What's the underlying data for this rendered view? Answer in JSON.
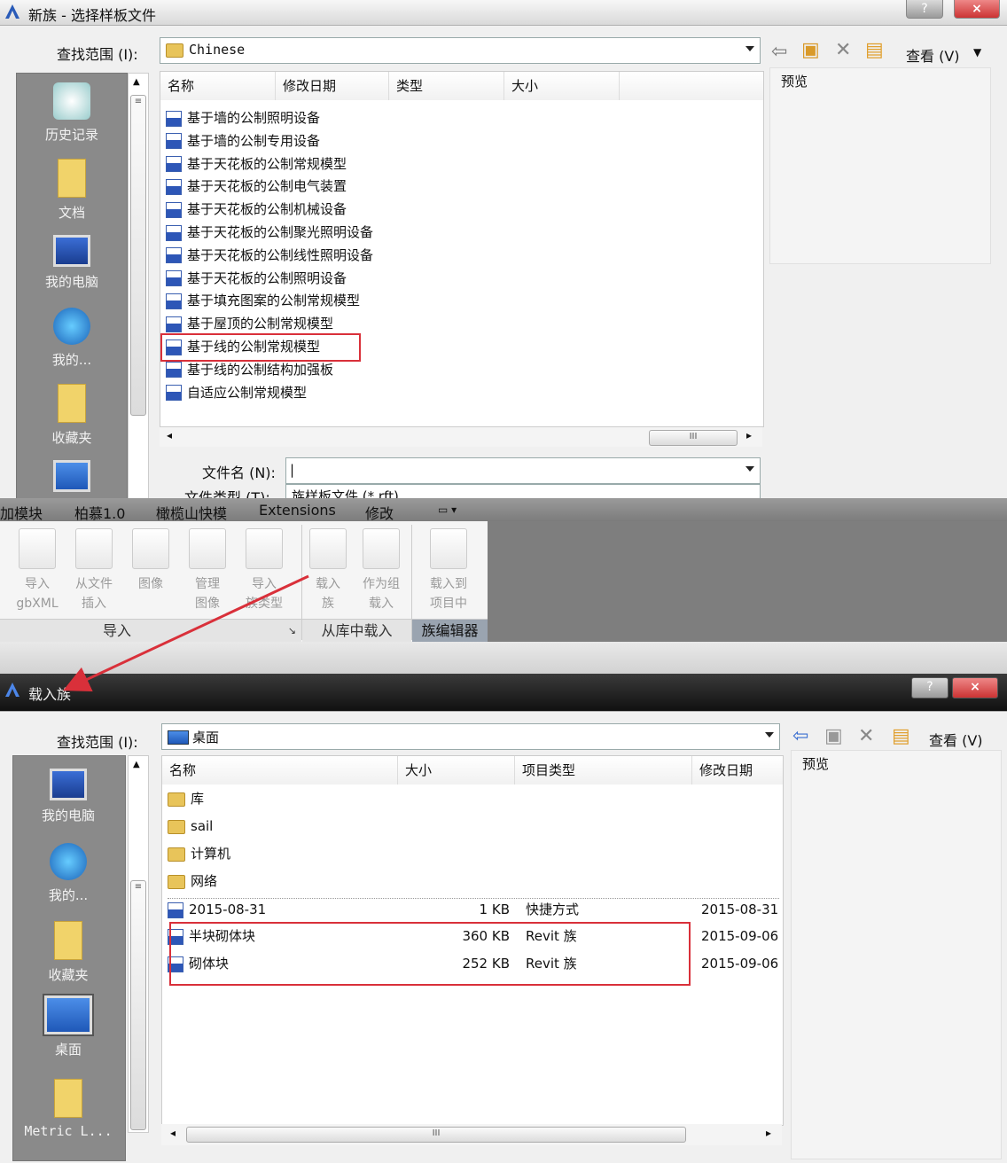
{
  "dialog1": {
    "title": "新族 - 选择样板文件",
    "help": "?",
    "close": "×",
    "look_in_label": "查找范围 (I):",
    "look_in_value": "Chinese",
    "view_label": "查看 (V)",
    "preview_label": "预览",
    "columns": [
      "名称",
      "修改日期",
      "类型",
      "大小"
    ],
    "files": [
      "基于墙的公制照明设备",
      "基于墙的公制专用设备",
      "基于天花板的公制常规模型",
      "基于天花板的公制电气装置",
      "基于天花板的公制机械设备",
      "基于天花板的公制聚光照明设备",
      "基于天花板的公制线性照明设备",
      "基于天花板的公制照明设备",
      "基于填充图案的公制常规模型",
      "基于屋顶的公制常规模型",
      "基于线的公制常规模型",
      "基于线的公制结构加强板",
      "自适应公制常规模型"
    ],
    "places": [
      "历史记录",
      "文档",
      "我的电脑",
      "我的...",
      "收藏夹"
    ],
    "filename_label": "文件名 (N):",
    "filename_value": "|",
    "filetype_label": "文件类型 (T):",
    "filetype_value": "族样板文件 (*.rft)"
  },
  "ribbon": {
    "tabs": [
      "加模块",
      "柏慕1.0",
      "橄榄山快模",
      "Extensions",
      "修改"
    ],
    "tab_arrow": "▭ ▾",
    "import_buttons": [
      {
        "line1": "导入",
        "line2": "gbXML"
      },
      {
        "line1": "从文件",
        "line2": "插入"
      },
      {
        "line1": "图像",
        "line2": ""
      },
      {
        "line1": "管理",
        "line2": "图像"
      },
      {
        "line1": "导入",
        "line2": "族类型"
      }
    ],
    "library_buttons": [
      {
        "line1": "载入",
        "line2": "族"
      },
      {
        "line1": "作为组",
        "line2": "载入"
      }
    ],
    "editor_buttons": [
      {
        "line1": "载入到",
        "line2": "项目中"
      }
    ],
    "panel_import": "导入",
    "panel_import_launcher": "↘",
    "panel_library": "从库中载入",
    "panel_editor": "族编辑器"
  },
  "dialog2": {
    "title": "载入族",
    "help": "?",
    "close": "×",
    "look_in_label": "查找范围 (I):",
    "look_in_value": "桌面",
    "view_label": "查看 (V)",
    "preview_label": "预览",
    "columns": [
      "名称",
      "大小",
      "项目类型",
      "修改日期"
    ],
    "rows": [
      {
        "name": "库",
        "size": "",
        "type": "",
        "date": ""
      },
      {
        "name": "sail",
        "size": "",
        "type": "",
        "date": ""
      },
      {
        "name": "计算机",
        "size": "",
        "type": "",
        "date": ""
      },
      {
        "name": "网络",
        "size": "",
        "type": "",
        "date": ""
      },
      {
        "name": "2015-08-31",
        "size": "1 KB",
        "type": "快捷方式",
        "date": "2015-08-31"
      },
      {
        "name": "半块砌体块",
        "size": "360 KB",
        "type": "Revit 族",
        "date": "2015-09-06"
      },
      {
        "name": "砌体块",
        "size": "252 KB",
        "type": "Revit 族",
        "date": "2015-09-06"
      }
    ],
    "places": [
      "我的电脑",
      "我的...",
      "收藏夹",
      "桌面",
      "Metric L..."
    ]
  },
  "colors": {
    "highlight": "#d9303a",
    "arrow": "#d9303a",
    "places_bg": "#8a8a8a"
  }
}
